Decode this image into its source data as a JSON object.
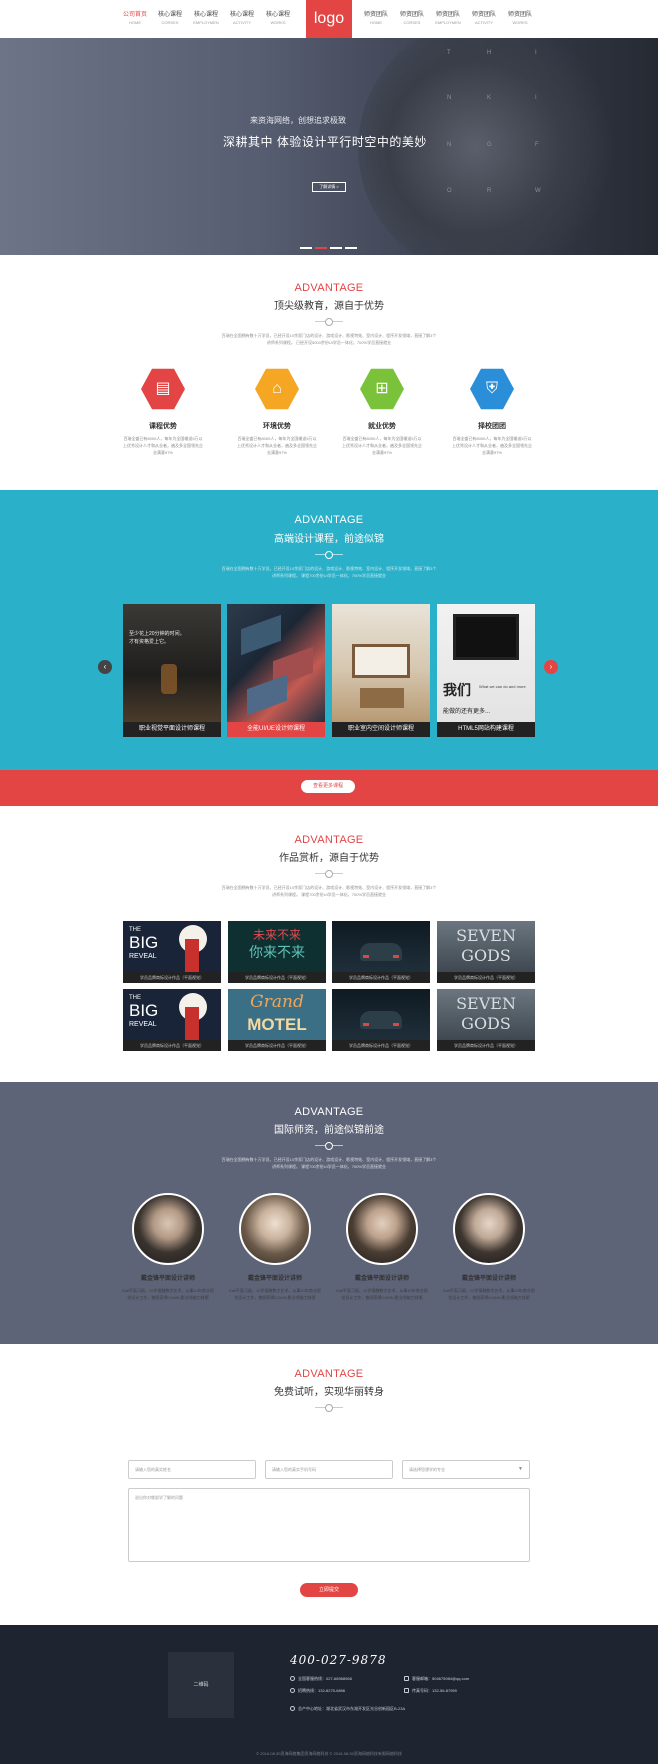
{
  "nav": {
    "logo": "logo",
    "items": [
      {
        "zh": "公司首页",
        "en": "HOME"
      },
      {
        "zh": "核心课程",
        "en": "CORSES"
      },
      {
        "zh": "核心课程",
        "en": "EMPLOYMEN"
      },
      {
        "zh": "核心课程",
        "en": "ACTIVITY"
      },
      {
        "zh": "核心课程",
        "en": "WORKS"
      },
      {
        "zh": "师资团队",
        "en": "HOME"
      },
      {
        "zh": "师资团队",
        "en": "CORSES"
      },
      {
        "zh": "师资团队",
        "en": "EMPLOYMEN"
      },
      {
        "zh": "师资团队",
        "en": "ACTIVITY"
      },
      {
        "zh": "师资团队",
        "en": "WORKS"
      }
    ]
  },
  "hero": {
    "subtitle": "来资海网络，创想追求极致",
    "title": "深耕其中  体验设计平行时空中的美妙",
    "button": "了解详情 >",
    "letters": [
      "T",
      "H",
      "I",
      "N",
      "K",
      "I",
      "N",
      "G",
      "F",
      "O",
      "R",
      "W"
    ]
  },
  "advantages": {
    "en": "ADVANTAGE",
    "zh": "顶尖级教育，源自于优势",
    "desc": "百瑞在全国拥有数十万学员，已经开设10余家门店的设计、游戏设计、影视特效、室内设计、程序开发领域，直接了解3个讲师系列课程。",
    "desc2": "已经开设5000余份UI学员一体化，700%学员直接就业",
    "items": [
      {
        "icon": "book-icon",
        "title": "课程优势",
        "desc": "百瑞全盛已有8000人，每年为全国输送5万以上优秀设计人才和从业者，遍及多全国领先企业满意97%"
      },
      {
        "icon": "environment-icon",
        "title": "环境优势",
        "desc": "百瑞全盛已有8000人，每年为全国输送5万以上优秀设计人才和从业者，遍及多全国领先企业满意97%"
      },
      {
        "icon": "employment-icon",
        "title": "就业优势",
        "desc": "百瑞全盛已有8000人，每年为全国输送5万以上优秀设计人才和从业者，遍及多全国领先企业满意97%"
      },
      {
        "icon": "shield-icon",
        "title": "择校团团",
        "desc": "百瑞全盛已有8000人，每年为全国输送5万以上优秀设计人才和从业者，遍及多全国领先企业满意97%"
      }
    ]
  },
  "courses": {
    "en": "ADVANTAGE",
    "zh": "高端设计课程，前途似锦",
    "desc": "百瑞在全国拥有数十万学员，已经开设10余家门店的设计、游戏设计、影视特效、室内设计、程序开发领域，直接了解3个讲师系列课程。",
    "desc2": "课程700余份UI学员一体化，700%学员直接就业",
    "items": [
      {
        "label": "职业视觉平面设计师课程",
        "overlay1": "至少花上20分钟的时间，",
        "overlay2": "才有资格爱上它。"
      },
      {
        "label": "全能UI/UE设计师课程",
        "overlay1": "",
        "overlay2": ""
      },
      {
        "label": "职业室内空间设计师课程",
        "overlay1": "",
        "overlay2": ""
      },
      {
        "label": "HTML5网站构建课程",
        "overlay1": "我们",
        "overlay2": "能做的还有更多..."
      }
    ],
    "overlay_en": "What we can do and more",
    "more_button": "查看更多课程"
  },
  "works": {
    "en": "ADVANTAGE",
    "zh": "作品赏析，源自于优势",
    "desc": "百瑞在全国拥有数十万学员，已经开设10余家门店的设计、游戏设计、影视特效、室内设计、程序开发领域，直接了解3个讲师系列课程。",
    "desc2": "课程700余份UI学员一体化，700%学员直接就业",
    "caption": "学员品牌商标设计作品（平面视觉）",
    "art": [
      {
        "line1": "THE",
        "line2": "BIG",
        "line3": "REVEAL"
      },
      {
        "line1": "未来不来",
        "line2": "你来不来",
        "line3": ""
      },
      {
        "line1": "",
        "line2": "",
        "line3": ""
      },
      {
        "line1": "SEVEN",
        "line2": "GODS",
        "line3": ""
      },
      {
        "line1": "THE",
        "line2": "BIG",
        "line3": "REVEAL"
      },
      {
        "line1": "Grand",
        "line2": "MOTEL",
        "line3": ""
      },
      {
        "line1": "",
        "line2": "",
        "line3": ""
      },
      {
        "line1": "SEVEN",
        "line2": "GODS",
        "line3": ""
      }
    ]
  },
  "teachers": {
    "en": "ADVANTAGE",
    "zh": "国际师资，前途似锦前途",
    "desc": "百瑞在全国拥有数十万学员，已经开设10余家门店的设计、游戏设计、影视特效、室内设计、程序开发领域，直接了解3个讲师系列课程。",
    "desc2": "课程700余份UI学员一体化，700%学员直接就业",
    "items": [
      {
        "name": "戴金锋平面设计讲师",
        "desc": "Kali平面习画，12岁接触数字艺术，从事10年商业视觉设计工作，曾经获得ICANN,影业领袖力排第"
      },
      {
        "name": "戴金锋平面设计讲师",
        "desc": "Kali平面习画，12岁接触数字艺术，从事10年商业视觉设计工作，曾经获得ICANN,影业领袖力排第"
      },
      {
        "name": "戴金锋平面设计讲师",
        "desc": "Kali平面习画，12岁接触数字艺术，从事10年商业视觉设计工作，曾经获得ICANN,影业领袖力排第"
      },
      {
        "name": "戴金锋平面设计讲师",
        "desc": "Kali平面习画，12岁接触数字艺术，从事10年商业视觉设计工作，曾经获得ICANN,影业领袖力排第"
      }
    ]
  },
  "trial": {
    "en": "ADVANTAGE",
    "zh": "免费试听，实现华丽转身",
    "name_placeholder": "请输入您的真实姓名",
    "phone_placeholder": "请输入您的真实手机号码",
    "course_placeholder": "请选择您想学的专业",
    "message_placeholder": "说出你对哪部学了解的问题",
    "submit": "立即提交"
  },
  "footer": {
    "qr": "二维码",
    "phone": "400-027-9878",
    "contacts": [
      "全国客服热线：027-68968968",
      "客服邮箱：504675984@qq.com",
      "招聘热线：132-8275-6896",
      "传真号码：132-56-87959"
    ],
    "address": "总产中心地址：湖北省武汉市东湖开发区光谷创新园区B-23A",
    "copyright": "© 2016-08.30资海网络集团资海网络科技  © 2016-08.30资海网络科技有限网络科技"
  },
  "colors": {
    "accent": "#e34545",
    "teal": "#2ab0c8",
    "slate": "#5d6477",
    "footer": "#1f2530",
    "orange": "#f5a623",
    "green": "#7ac23a",
    "blue": "#2a8ed8"
  }
}
